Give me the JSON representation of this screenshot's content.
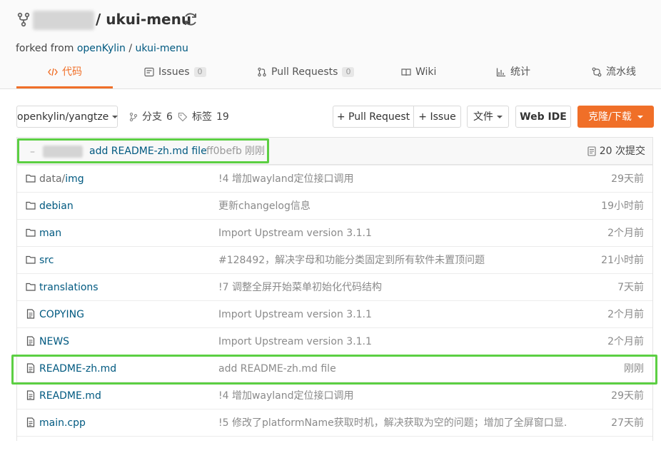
{
  "repo": {
    "name": "/ ukui-menu",
    "forked_prefix": "forked from",
    "forked_owner": "openKylin",
    "forked_sep": "/",
    "forked_repo": "ukui-menu"
  },
  "tabs": [
    {
      "label": "代码",
      "icon": "code-icon",
      "active": true
    },
    {
      "label": "Issues",
      "badge": "0",
      "icon": "issues-icon"
    },
    {
      "label": "Pull Requests",
      "badge": "0",
      "icon": "pull-request-icon"
    },
    {
      "label": "Wiki",
      "icon": "wiki-icon"
    },
    {
      "label": "统计",
      "icon": "stats-icon"
    },
    {
      "label": "流水线",
      "icon": "pipeline-icon"
    }
  ],
  "toolbar": {
    "branch": "openkylin/yangtze",
    "branches_label": "分支",
    "branches_count": "6",
    "tags_label": "标签",
    "tags_count": "19",
    "pull_request": "+ Pull Request",
    "issue": "+ Issue",
    "file_menu": "文件",
    "web_ide": "Web IDE",
    "clone": "克隆/下载"
  },
  "latest_commit": {
    "dash": "–",
    "message": "add README-zh.md file",
    "hash": "ff0befb",
    "time": "刚刚",
    "count_label": "20 次提交"
  },
  "files": [
    {
      "type": "folder",
      "name_dim": "data/",
      "name": "img",
      "message": "!4 增加wayland定位接口调用",
      "time": "29天前"
    },
    {
      "type": "folder",
      "name": "debian",
      "message": "更新changelog信息",
      "time": "19小时前"
    },
    {
      "type": "folder",
      "name": "man",
      "message": "Import Upstream version 3.1.1",
      "time": "2个月前"
    },
    {
      "type": "folder",
      "name": "src",
      "message": "#128492，解决字母和功能分类固定到所有软件未置顶问题",
      "time": "21小时前"
    },
    {
      "type": "folder",
      "name": "translations",
      "message": "!7 调整全屏开始菜单初始化代码结构",
      "time": "7天前"
    },
    {
      "type": "file",
      "name": "COPYING",
      "message": "Import Upstream version 3.1.1",
      "time": "2个月前"
    },
    {
      "type": "file",
      "name": "NEWS",
      "message": "Import Upstream version 3.1.1",
      "time": "2个月前"
    },
    {
      "type": "file",
      "name": "README-zh.md",
      "message": "add README-zh.md file",
      "time": "刚刚"
    },
    {
      "type": "file",
      "name": "README.md",
      "message": "!4 增加wayland定位接口调用",
      "time": "29天前"
    },
    {
      "type": "file",
      "name": "main.cpp",
      "message": "!5 修改了platformName获取时机，解决获取为空的问题；增加了全屏窗口显…",
      "time": "27天前"
    }
  ],
  "colors": {
    "accent": "#f06f28",
    "link": "#005980",
    "highlight": "#5ccf43"
  }
}
